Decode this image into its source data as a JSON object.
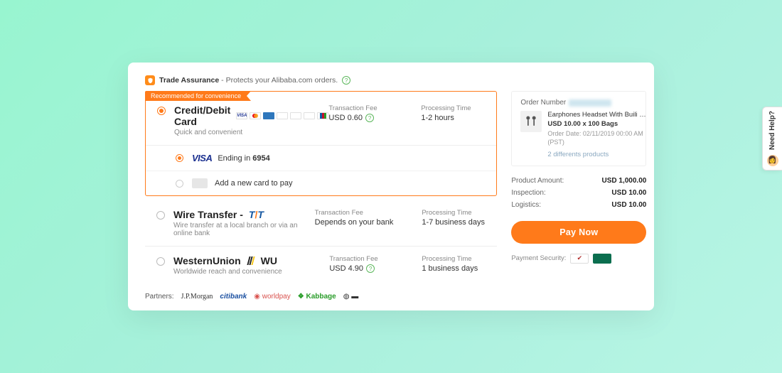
{
  "assurance": {
    "bold": "Trade Assurance",
    "rest": " - Protects your Alibaba.com orders."
  },
  "ribbon": "Recommended for convenience",
  "fee_label": "Transaction Fee",
  "time_label": "Processing Time",
  "methods": {
    "card": {
      "title": "Credit/Debit Card",
      "sub": "Quick and convenient",
      "fee": "USD 0.60",
      "time": "1-2 hours"
    },
    "wire": {
      "title": "Wire Transfer - ",
      "sub": "Wire transfer at a local branch or via an online bank",
      "fee": "Depends on your bank",
      "time": "1-7 business days"
    },
    "wu": {
      "title_prefix": "WesternUnion",
      "title_wu": "WU",
      "sub": "Worldwide reach and convenience",
      "fee": "USD 4.90",
      "time": "1 business days"
    }
  },
  "saved_card": {
    "brand": "VISA",
    "ending_label": "Ending in",
    "last4": "6954"
  },
  "add_card": "Add a new card to pay",
  "order": {
    "label": "Order Number",
    "product_title": "Earphones Headset With Buili phone one …",
    "price_line": "USD 10.00 x 100 Bags",
    "date_line": "Order Date: 02/11/2019 00:00 AM (PST)",
    "diff": "2 differents products"
  },
  "totals": {
    "product_label": "Product Amount:",
    "product_val": "USD 1,000.00",
    "inspection_label": "Inspection:",
    "inspection_val": "USD 10.00",
    "logistics_label": "Logistics:",
    "logistics_val": "USD 10.00"
  },
  "paynow": "Pay Now",
  "security_label": "Payment Security:",
  "partners": {
    "label": "Partners:",
    "jp": "J.P.Morgan",
    "citi": "citibank",
    "wp": "worldpay",
    "kb": "Kabbage"
  },
  "help": "Need Help?"
}
